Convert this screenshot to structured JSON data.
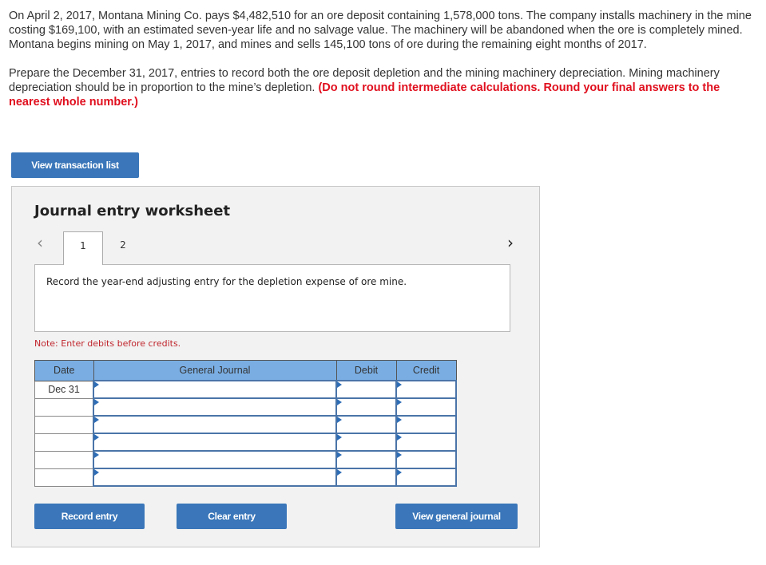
{
  "problem": {
    "paragraph1": "On April 2, 2017, Montana Mining Co. pays $4,482,510 for an ore deposit containing 1,578,000 tons. The company installs machinery in the mine costing $169,100, with an estimated seven-year life and no salvage value. The machinery will be abandoned when the ore is completely mined. Montana begins mining on May 1, 2017, and mines and sells 145,100 tons of ore during the remaining eight months of 2017.",
    "paragraph2": "Prepare the December 31, 2017, entries to record both the ore deposit depletion and the mining machinery depreciation. Mining machinery depreciation should be in proportion to the mine’s depletion.",
    "paragraph2_emphasis": "(Do not round intermediate calculations. Round your final answers to the nearest whole number.)"
  },
  "buttons": {
    "view_transaction_list": "View transaction list",
    "record_entry": "Record entry",
    "clear_entry": "Clear entry",
    "view_general_journal": "View general journal"
  },
  "worksheet": {
    "title": "Journal entry worksheet",
    "prev_icon": "‹",
    "next_icon": "›",
    "tabs": [
      {
        "label": "1",
        "active": true
      },
      {
        "label": "2",
        "active": false
      }
    ],
    "instruction": "Record the year-end adjusting entry for the depletion expense of ore mine.",
    "note": "Note: Enter debits before credits.",
    "table": {
      "headers": [
        "Date",
        "General Journal",
        "Debit",
        "Credit"
      ],
      "rows": [
        {
          "date": "Dec 31",
          "account": "",
          "debit": "",
          "credit": ""
        },
        {
          "date": "",
          "account": "",
          "debit": "",
          "credit": ""
        },
        {
          "date": "",
          "account": "",
          "debit": "",
          "credit": ""
        },
        {
          "date": "",
          "account": "",
          "debit": "",
          "credit": ""
        },
        {
          "date": "",
          "account": "",
          "debit": "",
          "credit": ""
        },
        {
          "date": "",
          "account": "",
          "debit": "",
          "credit": ""
        }
      ]
    }
  },
  "colors": {
    "button_blue": "#3a76b9",
    "header_blue": "#7aaee3",
    "emphasis_red": "#e00f1e",
    "note_red": "#c0262d"
  }
}
